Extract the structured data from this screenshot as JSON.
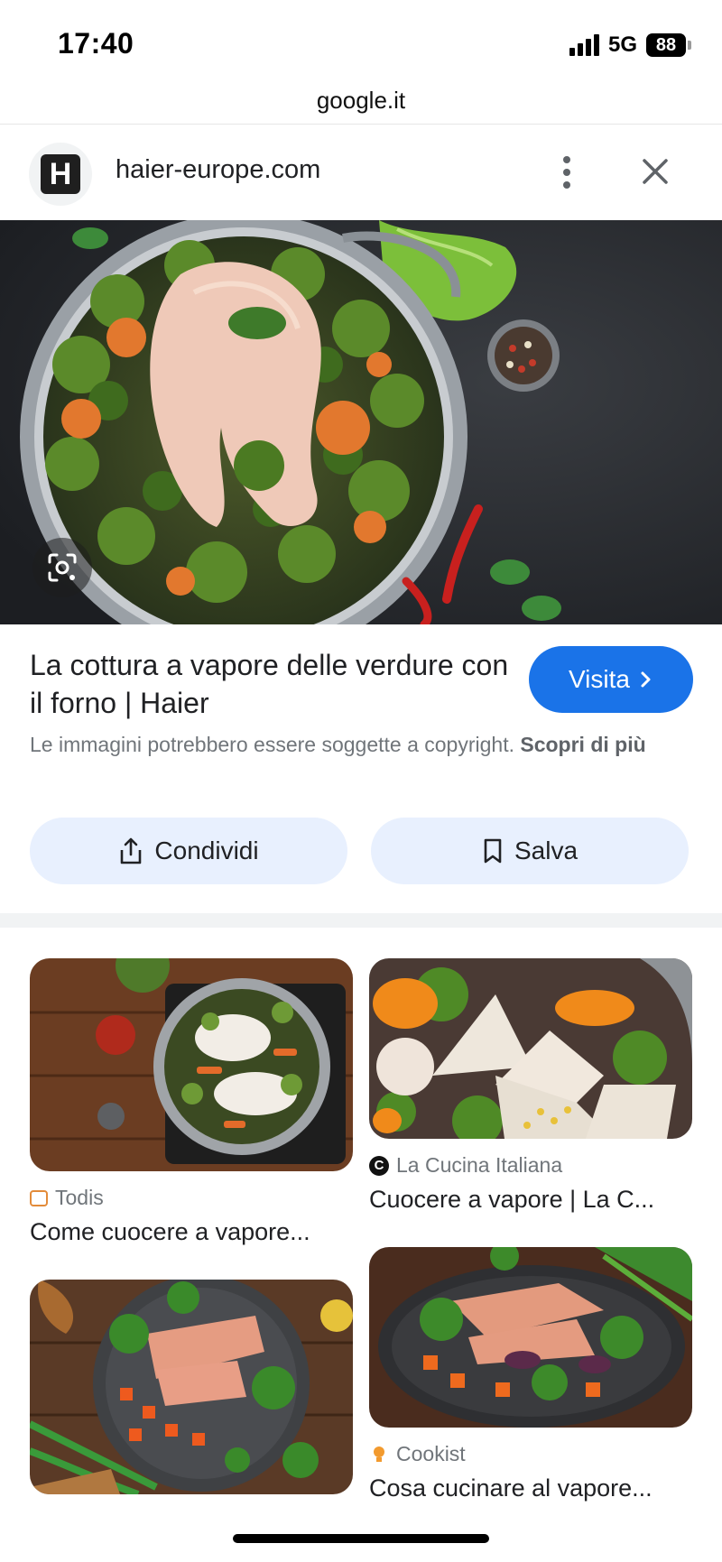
{
  "status_bar": {
    "time": "17:40",
    "network": "5G",
    "battery": "88"
  },
  "url_bar": {
    "domain": "google.it"
  },
  "site": {
    "favicon_letter": "H",
    "name": "haier-europe.com"
  },
  "result": {
    "title": "La cottura a vapore delle verdure con il forno | Haier",
    "visit_label": "Visita",
    "copyright_text": "Le immagini potrebbero essere soggette a copyright.",
    "learn_more": "Scopri di più",
    "share_label": "Condividi",
    "save_label": "Salva"
  },
  "related": [
    {
      "source": "Todis",
      "title": "Come cuocere a vapore..."
    },
    {
      "source": "La Cucina Italiana",
      "title": "Cuocere a vapore | La C..."
    },
    {
      "source": "",
      "title": ""
    },
    {
      "source": "Cookist",
      "title": "Cosa cucinare al vapore..."
    }
  ],
  "colors": {
    "accent": "#1a73e8",
    "chip_bg": "#e8f0fe",
    "muted_text": "#70757a"
  },
  "icons": [
    "more-vert-icon",
    "close-icon",
    "google-lens-icon",
    "chevron-right-icon",
    "share-icon",
    "bookmark-icon"
  ]
}
